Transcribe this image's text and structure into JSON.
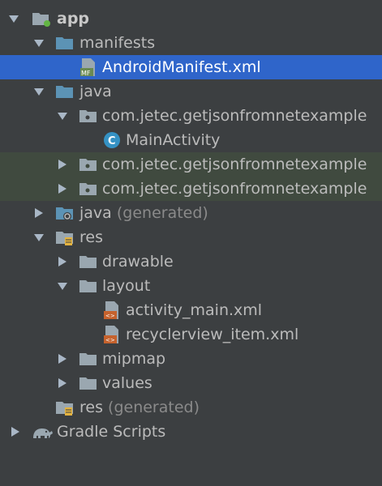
{
  "tree": {
    "app": {
      "label": "app",
      "icon": "module-folder-icon",
      "state": "expanded"
    },
    "manifests": {
      "label": "manifests",
      "icon": "folder-icon",
      "state": "expanded"
    },
    "android_manifest": {
      "label": "AndroidManifest.xml",
      "icon": "manifest-file-icon",
      "badge": "MF",
      "selected": true
    },
    "java": {
      "label": "java",
      "icon": "folder-icon",
      "state": "expanded"
    },
    "pkg_main": {
      "label": "com.jetec.getjsonfromnetexample",
      "icon": "package-icon",
      "state": "expanded"
    },
    "main_activity": {
      "label": "MainActivity",
      "icon": "class-icon",
      "badge": "C"
    },
    "pkg_android_test": {
      "label": "com.jetec.getjsonfromnetexample",
      "icon": "package-icon",
      "state": "collapsed"
    },
    "pkg_test": {
      "label": "com.jetec.getjsonfromnetexample",
      "icon": "package-icon",
      "state": "collapsed"
    },
    "java_generated": {
      "label": "java",
      "suffix": "(generated)",
      "icon": "generated-java-folder-icon",
      "state": "collapsed"
    },
    "res": {
      "label": "res",
      "icon": "resource-folder-icon",
      "state": "expanded"
    },
    "drawable": {
      "label": "drawable",
      "icon": "folder-icon",
      "state": "collapsed"
    },
    "layout": {
      "label": "layout",
      "icon": "folder-icon",
      "state": "expanded"
    },
    "activity_main": {
      "label": "activity_main.xml",
      "icon": "layout-file-icon",
      "badge": "<>"
    },
    "recyclerview_item": {
      "label": "recyclerview_item.xml",
      "icon": "layout-file-icon",
      "badge": "<>"
    },
    "mipmap": {
      "label": "mipmap",
      "icon": "folder-icon",
      "state": "collapsed"
    },
    "values": {
      "label": "values",
      "icon": "folder-icon",
      "state": "collapsed"
    },
    "res_generated": {
      "label": "res",
      "suffix": "(generated)",
      "icon": "resource-folder-icon"
    },
    "gradle_scripts": {
      "label": "Gradle Scripts",
      "icon": "gradle-elephant-icon",
      "state": "collapsed"
    }
  },
  "colors": {
    "background": "#3c3f41",
    "selection": "#2f65ca",
    "tinted_row": "#404a3f",
    "folder": "#5c93b5",
    "package": "#9aa7b0",
    "manifest_badge": "#6a8a52",
    "layout_badge": "#c5622d",
    "class_badge": "#3592c4",
    "text": "#bbbbbb",
    "generated_text": "#8a8a8a"
  }
}
